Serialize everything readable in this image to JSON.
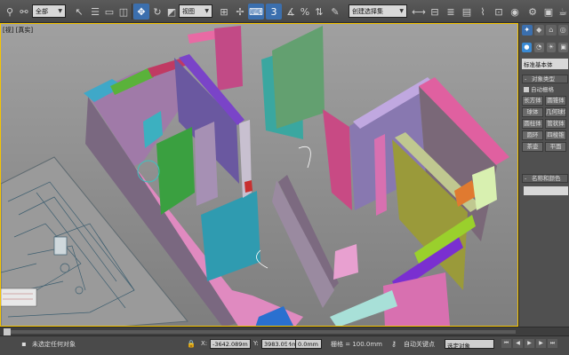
{
  "toolbar": {
    "selection_filter": "全部",
    "reference_coord": "视图",
    "named_selection": "创建选择集",
    "snap_value": "3"
  },
  "viewport": {
    "label_fragments": [
      "视",
      "真实"
    ]
  },
  "command_panel": {
    "category_dropdown": "标准基本体",
    "object_type_section": "对象类型",
    "autogrid_label": "自动栅格",
    "buttons": [
      "长方体",
      "圆锥体",
      "球体",
      "几何球体",
      "圆柱体",
      "管状体",
      "圆环",
      "四棱锥",
      "茶壶",
      "平面"
    ],
    "name_color_section": "名称和颜色",
    "colors": {
      "active": "#3a8ad4",
      "tab_active": "#3b6fae"
    }
  },
  "status": {
    "prompt": "未选定任何对象",
    "x_label": "X:",
    "x_value": "-3642.089m",
    "y_label": "Y:",
    "y_value": "3983.054m",
    "z_label": "Z:",
    "z_value": "0.0mm",
    "grid_label": "栅格 = 100.0mm",
    "autokey_label": "自动关键点",
    "selected_dropdown": "选定对象"
  }
}
